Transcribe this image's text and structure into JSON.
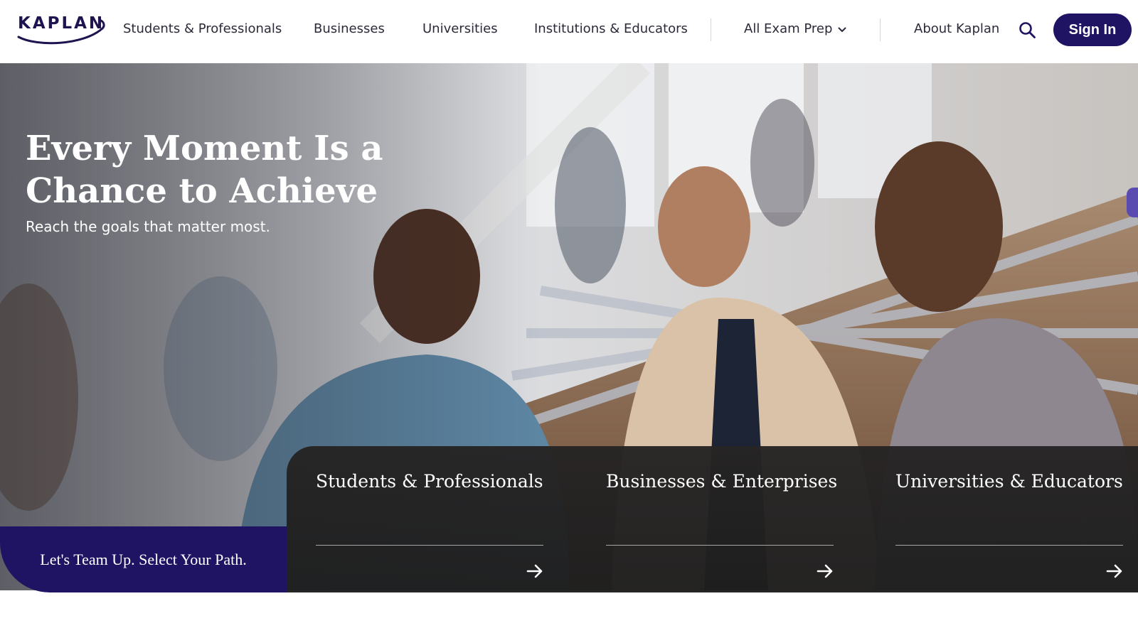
{
  "brand": {
    "logo_text": "KAPLAN",
    "primary_color": "#1f1463"
  },
  "nav": {
    "items": [
      {
        "label": "Students & Professionals"
      },
      {
        "label": "Businesses"
      },
      {
        "label": "Universities"
      },
      {
        "label": "Institutions & Educators"
      },
      {
        "label": "All Exam Prep",
        "icon": "chevron-down-icon"
      },
      {
        "label": "About Kaplan"
      }
    ],
    "search_icon": "search-icon",
    "signin_label": "Sign In"
  },
  "hero": {
    "title": "Every Moment Is a Chance to Achieve",
    "subtitle": "Reach the goals that matter most."
  },
  "paths": {
    "cta": "Let's Team Up. Select Your Path.",
    "cards": [
      {
        "title": "Students & Professionals",
        "icon": "arrow-right-icon"
      },
      {
        "title": "Businesses & Enterprises",
        "icon": "arrow-right-icon"
      },
      {
        "title": "Universities & Educators",
        "icon": "arrow-right-icon"
      }
    ]
  }
}
